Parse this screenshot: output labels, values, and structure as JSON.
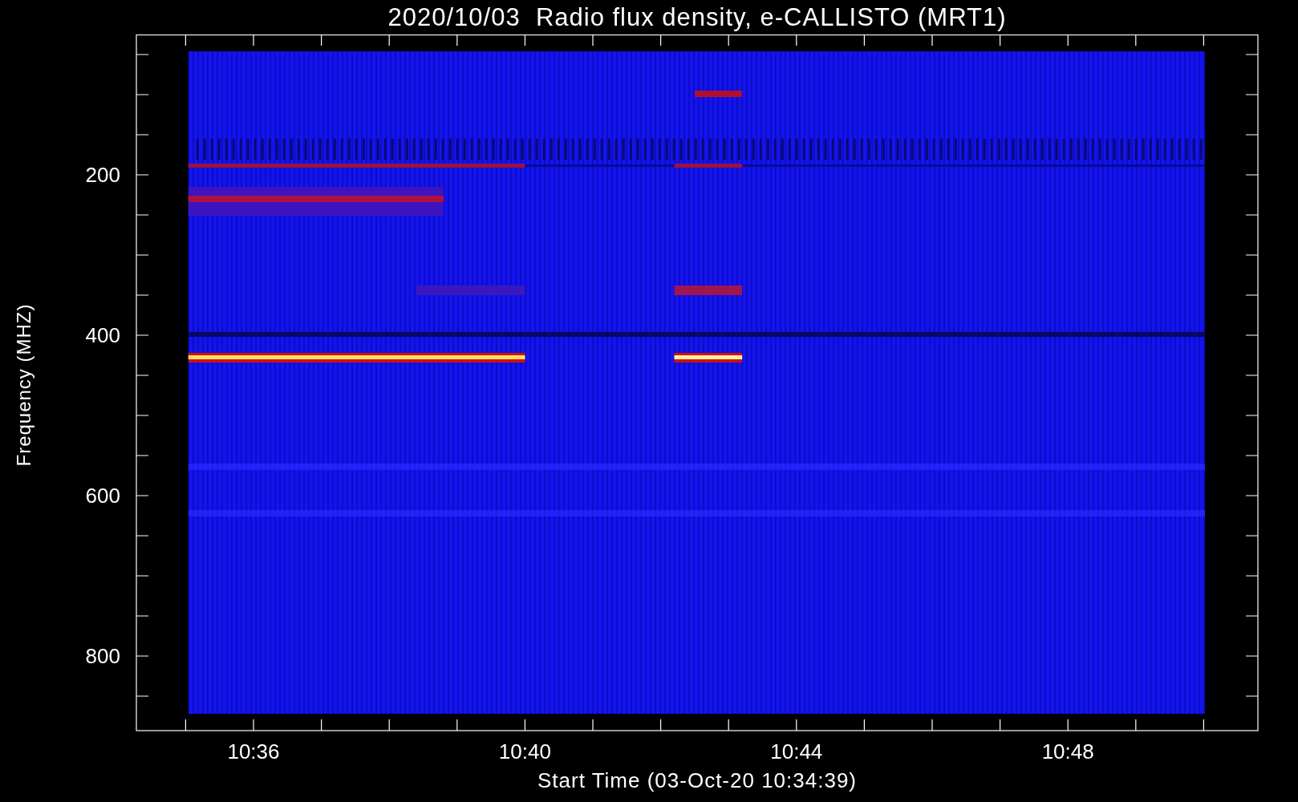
{
  "title": "2020/10/03  Radio flux density, e-CALLISTO (MRT1)",
  "y_axis": {
    "label": "Frequency (MHZ)",
    "ticks": [
      "200",
      "400",
      "600",
      "800"
    ]
  },
  "x_axis": {
    "label": "Start Time (03-Oct-20 10:34:39)",
    "ticks": [
      "10:36",
      "10:40",
      "10:44",
      "10:48"
    ]
  }
}
